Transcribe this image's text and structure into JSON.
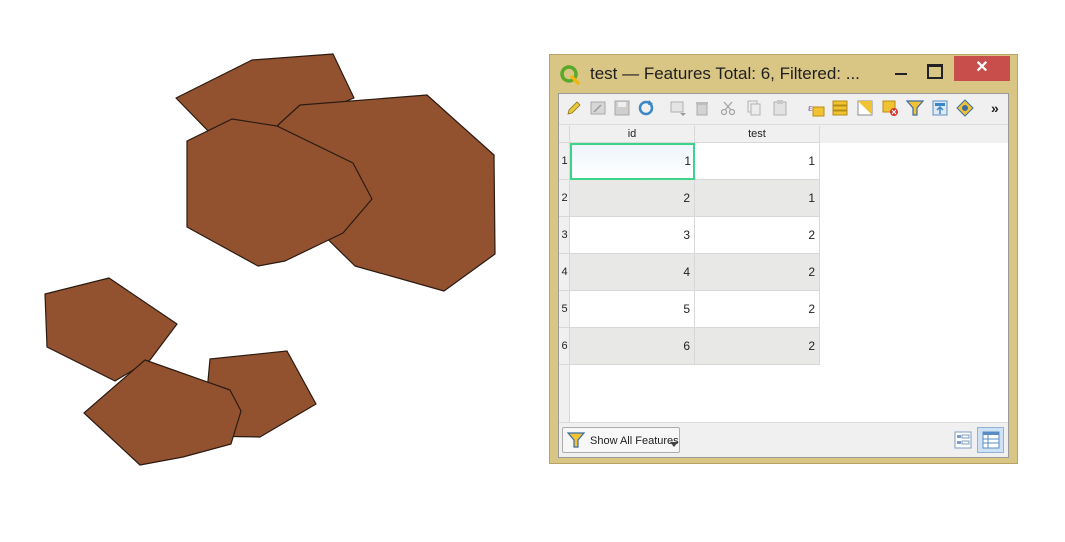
{
  "map": {
    "fill_color": "#93522f",
    "stroke_color": "#2a1a12"
  },
  "window": {
    "title": "test — Features Total: 6, Filtered: ...",
    "frame_color": "#d9c685",
    "close_glyph": "✕"
  },
  "toolbar": {
    "icons": [
      "edit-pencil-icon",
      "multi-edit-icon",
      "save-edits-icon",
      "reload-icon",
      "add-feature-icon",
      "delete-feature-icon",
      "cut-icon",
      "copy-icon",
      "paste-icon",
      "expression-select-icon",
      "select-all-icon",
      "invert-selection-icon",
      "deselect-all-icon",
      "filter-select-icon",
      "move-selection-top-icon",
      "pan-to-selection-icon"
    ],
    "more_glyph": "»"
  },
  "table": {
    "columns": [
      "id",
      "test"
    ],
    "rows": [
      {
        "row": "1",
        "id": "1",
        "test": "1"
      },
      {
        "row": "2",
        "id": "2",
        "test": "1"
      },
      {
        "row": "3",
        "id": "3",
        "test": "2"
      },
      {
        "row": "4",
        "id": "4",
        "test": "2"
      },
      {
        "row": "5",
        "id": "5",
        "test": "2"
      },
      {
        "row": "6",
        "id": "6",
        "test": "2"
      }
    ],
    "selection_color": "#3ed38a"
  },
  "bottom": {
    "show_all_label": "Show All Features",
    "view_buttons": [
      "form-view-icon",
      "table-view-icon"
    ]
  }
}
